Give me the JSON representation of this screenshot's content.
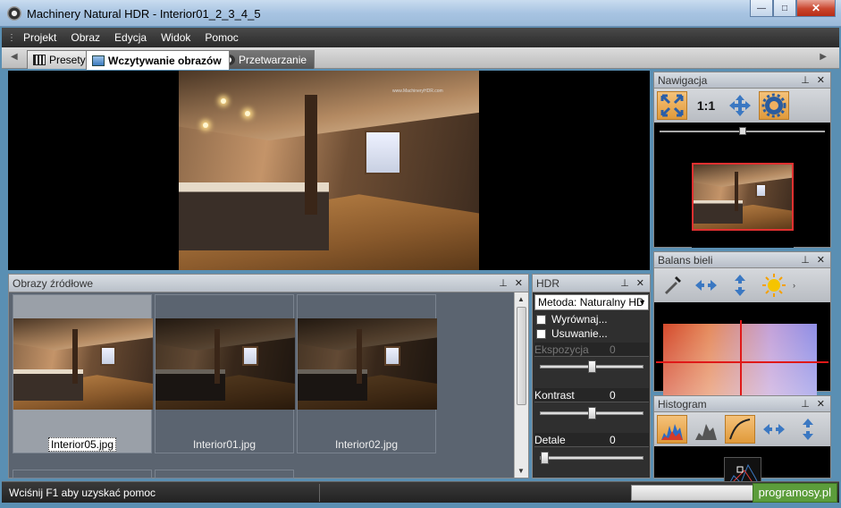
{
  "window": {
    "title": "Machinery Natural HDR - Interior01_2_3_4_5",
    "minimize": "—",
    "maximize": "□",
    "close": "✕"
  },
  "menu": {
    "items": [
      "Projekt",
      "Obraz",
      "Edycja",
      "Widok",
      "Pomoc"
    ]
  },
  "tabs": {
    "items": [
      {
        "label": "Presety",
        "icon": "presets-icon",
        "state": "inactive"
      },
      {
        "label": "Wczytywanie obrazów",
        "icon": "load-images-icon",
        "state": "active"
      },
      {
        "label": "Przetwarzanie",
        "icon": "process-icon",
        "state": "inactive"
      }
    ]
  },
  "preview": {
    "watermark": "www.MachineryHDR.com"
  },
  "source_panel": {
    "title": "Obrazy źródłowe",
    "thumbnails": [
      {
        "name": "Interior05.jpg",
        "selected": true
      },
      {
        "name": "Interior01.jpg",
        "selected": false
      },
      {
        "name": "Interior02.jpg",
        "selected": false
      }
    ]
  },
  "hdr_panel": {
    "title": "HDR",
    "method": "Metoda: Naturalny HD",
    "align_label": "Wyrównaj...",
    "remove_label": "Usuwanie...",
    "exposure_label": "Ekspozycja",
    "exposure_value": "0",
    "contrast_label": "Kontrast",
    "contrast_value": "0",
    "detail_label": "Detale",
    "detail_value": "0",
    "exposure_slider_level": 0.5,
    "contrast_slider_level": 0.5,
    "detail_slider_level": 0.0
  },
  "navigation_panel": {
    "title": "Nawigacja",
    "one_to_one": "1:1",
    "zoom_level": 0.5
  },
  "white_balance_panel": {
    "title": "Balans bieli"
  },
  "histogram_panel": {
    "title": "Histogram"
  },
  "status": {
    "help_text": "Wciśnij F1 aby uzyskać pomoc",
    "brand": "programosy.pl"
  },
  "colors": {
    "accent": "#e09a3a",
    "marker": "#e01818",
    "brand_green": "#5c9d3b"
  }
}
